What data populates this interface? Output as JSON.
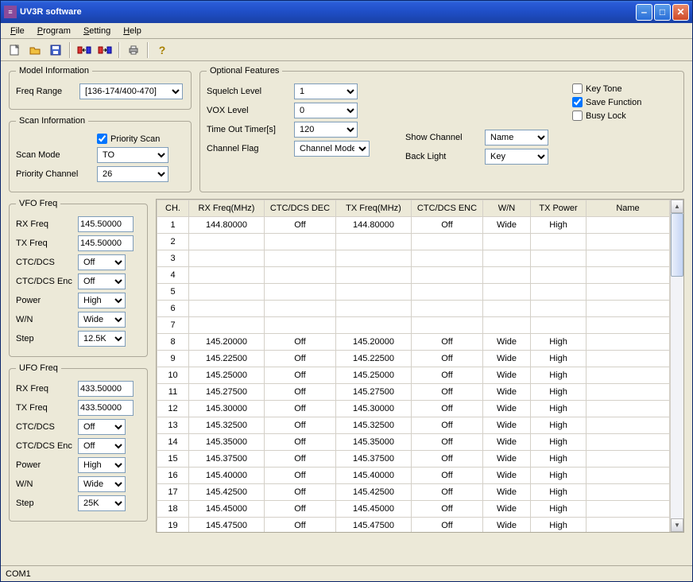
{
  "title": "UV3R software",
  "menu": {
    "file": "File",
    "program": "Program",
    "setting": "Setting",
    "help": "Help"
  },
  "model_info": {
    "legend": "Model Information",
    "freq_range_label": "Freq Range",
    "freq_range": "[136-174/400-470]"
  },
  "scan_info": {
    "legend": "Scan Information",
    "priority_scan_label": "Priority Scan",
    "priority_scan": true,
    "scan_mode_label": "Scan Mode",
    "scan_mode": "TO",
    "priority_channel_label": "Priority Channel",
    "priority_channel": "26"
  },
  "optional": {
    "legend": "Optional Features",
    "squelch_label": "Squelch Level",
    "squelch": "1",
    "vox_label": "VOX Level",
    "vox": "0",
    "timeout_label": "Time Out Timer[s]",
    "timeout": "120",
    "chflag_label": "Channel Flag",
    "chflag": "Channel Mode",
    "show_channel_label": "Show Channel",
    "show_channel": "Name",
    "back_light_label": "Back Light",
    "back_light": "Key",
    "key_tone_label": "Key Tone",
    "key_tone": false,
    "save_func_label": "Save Function",
    "save_func": true,
    "busy_lock_label": "Busy Lock",
    "busy_lock": false
  },
  "vfo": {
    "legend": "VFO Freq",
    "rx_label": "RX Freq",
    "rx": "145.50000",
    "tx_label": "TX Freq",
    "tx": "145.50000",
    "ctc_label": "CTC/DCS",
    "ctc": "Off",
    "ctcenc_label": "CTC/DCS Enc",
    "ctcenc": "Off",
    "power_label": "Power",
    "power": "High",
    "wn_label": "W/N",
    "wn": "Wide",
    "step_label": "Step",
    "step": "12.5K"
  },
  "ufo": {
    "legend": "UFO Freq",
    "rx_label": "RX Freq",
    "rx": "433.50000",
    "tx_label": "TX Freq",
    "tx": "433.50000",
    "ctc_label": "CTC/DCS",
    "ctc": "Off",
    "ctcenc_label": "CTC/DCS Enc",
    "ctcenc": "Off",
    "power_label": "Power",
    "power": "High",
    "wn_label": "W/N",
    "wn": "Wide",
    "step_label": "Step",
    "step": "25K"
  },
  "table": {
    "headers": [
      "CH.",
      "RX Freq(MHz)",
      "CTC/DCS DEC",
      "TX Freq(MHz)",
      "CTC/DCS ENC",
      "W/N",
      "TX Power",
      "Name"
    ],
    "rows": [
      {
        "ch": "1",
        "rx": "144.80000",
        "dec": "Off",
        "tx": "144.80000",
        "enc": "Off",
        "wn": "Wide",
        "pw": "High",
        "nm": ""
      },
      {
        "ch": "2",
        "rx": "",
        "dec": "",
        "tx": "",
        "enc": "",
        "wn": "",
        "pw": "",
        "nm": ""
      },
      {
        "ch": "3",
        "rx": "",
        "dec": "",
        "tx": "",
        "enc": "",
        "wn": "",
        "pw": "",
        "nm": ""
      },
      {
        "ch": "4",
        "rx": "",
        "dec": "",
        "tx": "",
        "enc": "",
        "wn": "",
        "pw": "",
        "nm": ""
      },
      {
        "ch": "5",
        "rx": "",
        "dec": "",
        "tx": "",
        "enc": "",
        "wn": "",
        "pw": "",
        "nm": ""
      },
      {
        "ch": "6",
        "rx": "",
        "dec": "",
        "tx": "",
        "enc": "",
        "wn": "",
        "pw": "",
        "nm": ""
      },
      {
        "ch": "7",
        "rx": "",
        "dec": "",
        "tx": "",
        "enc": "",
        "wn": "",
        "pw": "",
        "nm": ""
      },
      {
        "ch": "8",
        "rx": "145.20000",
        "dec": "Off",
        "tx": "145.20000",
        "enc": "Off",
        "wn": "Wide",
        "pw": "High",
        "nm": ""
      },
      {
        "ch": "9",
        "rx": "145.22500",
        "dec": "Off",
        "tx": "145.22500",
        "enc": "Off",
        "wn": "Wide",
        "pw": "High",
        "nm": ""
      },
      {
        "ch": "10",
        "rx": "145.25000",
        "dec": "Off",
        "tx": "145.25000",
        "enc": "Off",
        "wn": "Wide",
        "pw": "High",
        "nm": ""
      },
      {
        "ch": "11",
        "rx": "145.27500",
        "dec": "Off",
        "tx": "145.27500",
        "enc": "Off",
        "wn": "Wide",
        "pw": "High",
        "nm": ""
      },
      {
        "ch": "12",
        "rx": "145.30000",
        "dec": "Off",
        "tx": "145.30000",
        "enc": "Off",
        "wn": "Wide",
        "pw": "High",
        "nm": ""
      },
      {
        "ch": "13",
        "rx": "145.32500",
        "dec": "Off",
        "tx": "145.32500",
        "enc": "Off",
        "wn": "Wide",
        "pw": "High",
        "nm": ""
      },
      {
        "ch": "14",
        "rx": "145.35000",
        "dec": "Off",
        "tx": "145.35000",
        "enc": "Off",
        "wn": "Wide",
        "pw": "High",
        "nm": ""
      },
      {
        "ch": "15",
        "rx": "145.37500",
        "dec": "Off",
        "tx": "145.37500",
        "enc": "Off",
        "wn": "Wide",
        "pw": "High",
        "nm": ""
      },
      {
        "ch": "16",
        "rx": "145.40000",
        "dec": "Off",
        "tx": "145.40000",
        "enc": "Off",
        "wn": "Wide",
        "pw": "High",
        "nm": ""
      },
      {
        "ch": "17",
        "rx": "145.42500",
        "dec": "Off",
        "tx": "145.42500",
        "enc": "Off",
        "wn": "Wide",
        "pw": "High",
        "nm": ""
      },
      {
        "ch": "18",
        "rx": "145.45000",
        "dec": "Off",
        "tx": "145.45000",
        "enc": "Off",
        "wn": "Wide",
        "pw": "High",
        "nm": ""
      },
      {
        "ch": "19",
        "rx": "145.47500",
        "dec": "Off",
        "tx": "145.47500",
        "enc": "Off",
        "wn": "Wide",
        "pw": "High",
        "nm": ""
      }
    ]
  },
  "status": "COM1"
}
